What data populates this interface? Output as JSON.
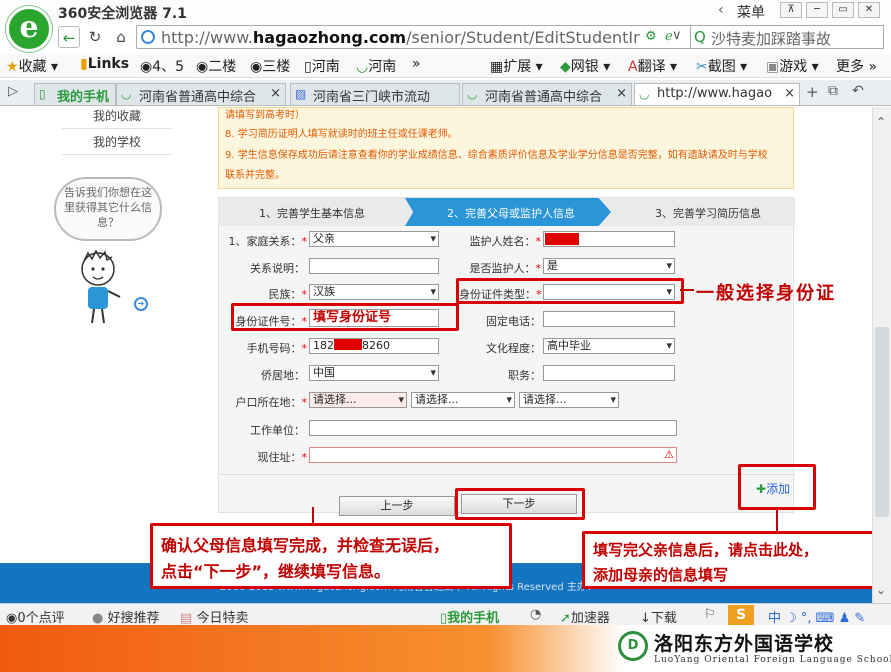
{
  "browser": {
    "title": "360安全浏览器 7.1",
    "menu_label": "菜单",
    "url_prefix": "http://www.",
    "url_domain": "hagaozhong.com",
    "url_path": "/senior/Student/EditStudentIr",
    "search_text": "沙特麦加踩踏事故"
  },
  "bookmarks": [
    "收藏",
    "Links",
    "4、5",
    "二楼",
    "三楼",
    "河南",
    "河南",
    "»",
    "扩展",
    "网银",
    "翻译",
    "截图",
    "游戏",
    "更多"
  ],
  "tabs": [
    {
      "label": "我的手机"
    },
    {
      "label": "河南省普通高中综合"
    },
    {
      "label": "河南省三门峡市流动"
    },
    {
      "label": "河南省普通高中综合"
    },
    {
      "label": "http://www.hagao"
    }
  ],
  "sidebar": {
    "links": [
      "我的收藏",
      "我的学校"
    ],
    "bubble": "告诉我们你想在这里获得其它什么信息？"
  },
  "notice": {
    "lines": [
      "请填写到高考时）",
      "8.   学习简历证明人填写就读时的班主任或任课老师。",
      "9.   学生信息保存成功后请注意查看你的学业成绩信息、综合素质评价信息及学业学分信息是否完整，如有遗缺请及时与学校",
      "      联系并完整。"
    ]
  },
  "steps": [
    "1、完善学生基本信息",
    "2、完善父母或监护人信息",
    "3、完善学习简历信息"
  ],
  "form": {
    "relation_label": "1、家庭关系：",
    "relation_value": "父亲",
    "guardian_name_label": "监护人姓名：",
    "relation_desc_label": "关系说明：",
    "is_guardian_label": "是否监护人：",
    "is_guardian_value": "是",
    "ethnicity_label": "民族：",
    "ethnicity_value": "汉族",
    "id_type_label": "身份证件类型：",
    "id_number_label": "身份证件号：",
    "id_number_hint": "填写身份证号",
    "phone_label": "固定电话：",
    "mobile_label": "手机号码：",
    "mobile_prefix": "182",
    "mobile_suffix": "8260",
    "education_label": "文化程度：",
    "education_value": "高中毕业",
    "residence_label": "侨居地：",
    "residence_value": "中国",
    "job_label": "职务：",
    "hukou_label": "户口所在地：",
    "hukou_select1": "请选择...",
    "hukou_select2": "请选择...",
    "hukou_select3": "请选择...",
    "work_label": "工作单位：",
    "address_label": "现住址：",
    "prev_button": "上一步",
    "next_button": "下一步",
    "add_button": "添加"
  },
  "annotations": {
    "id_type": "一般选择身份证",
    "next_line1": "确认父母信息填写完成，并检查无误后，",
    "next_line2": "点击“下一步”，继续填写信息。",
    "add_line1": "填写完父亲信息后，请点击此处，",
    "add_line2": "添加母亲的信息填写"
  },
  "footer": {
    "text": "2000-2013 www.hagaozhong.com 河南省普通高中 All Rights Reserved 主办："
  },
  "status": [
    "0个点评",
    "好搜推荐",
    "今日特卖",
    "我的手机",
    "加速器",
    "下载"
  ],
  "school": {
    "name": "洛阳东方外国语学校",
    "english": "LuoYang Oriental Foreign Language School",
    "logo_text": "D"
  },
  "colors": {
    "accent": "#2a96d8",
    "annotation": "#d80000",
    "footer": "#1574c0",
    "brand": "#2aa52e"
  }
}
